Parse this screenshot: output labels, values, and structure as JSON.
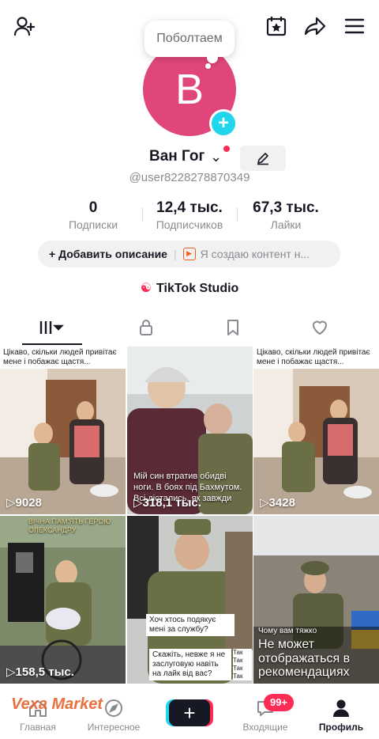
{
  "header": {
    "icons": [
      "add-friend-icon",
      "calendar-star-icon",
      "share-icon",
      "menu-icon"
    ]
  },
  "bubble": {
    "text": "Поболтаем"
  },
  "avatar": {
    "letter": "B",
    "color": "#e0467c"
  },
  "profile": {
    "name": "Ван Гог",
    "handle": "@user8228278870349"
  },
  "stats": [
    {
      "value": "0",
      "label": "Подписки"
    },
    {
      "value": "12,4 тыс.",
      "label": "Подписчиков"
    },
    {
      "value": "67,3 тыс.",
      "label": "Лайки"
    }
  ],
  "description": {
    "add_label": "+ Добавить описание",
    "creator_label": "Я создаю контент н..."
  },
  "studio": {
    "label": "TikTok Studio"
  },
  "videos": [
    {
      "views": "9028",
      "caption": "Цікаво, скільки людей привітає мене і побажає щастя..."
    },
    {
      "views": "318,1 тыс.",
      "caption": "Мій син втратив обидві ноги. В боях під Бахмутом. Всі дістались, як завжди"
    },
    {
      "views": "3428",
      "caption": "Цікаво, скільки людей привітає мене і побажає щастя..."
    },
    {
      "views": "158,5 тыс.",
      "caption": "ВІЧНА ПАМ'ЯТЬ ГЕРОЮ ОЛЕКСАНДРУ"
    },
    {
      "views": "",
      "caption": "Хоч хтось подякує мені за службу?",
      "caption2": "Скажіть, невже я не заслуговую навіть на лайк від вас?",
      "tags": [
        "Так",
        "Так",
        "Так",
        "Так"
      ]
    },
    {
      "views": "",
      "caption": "Чому вам тяжко",
      "notice": "Не может отображаться в рекомендациях"
    }
  ],
  "nav": {
    "home": "Главная",
    "discover": "Интересное",
    "inbox": "Входящие",
    "inbox_badge": "99+",
    "profile": "Профиль"
  },
  "watermark": "Vexa Market",
  "colors": {
    "accent": "#fe2c55",
    "cyan": "#20d5ec"
  }
}
